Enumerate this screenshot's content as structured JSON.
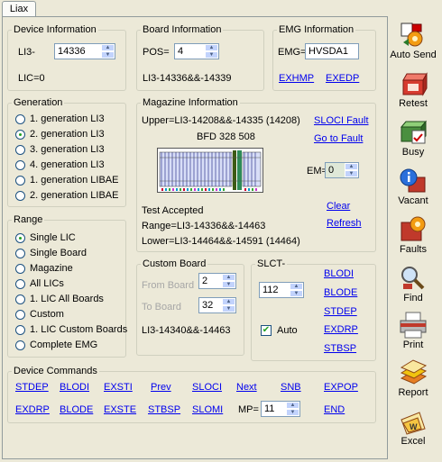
{
  "tab": {
    "label": "Liax"
  },
  "device_info": {
    "legend": "Device Information",
    "li_prefix": "LI3-",
    "li_value": "14336",
    "lic_text": "LIC=0"
  },
  "board_info": {
    "legend": "Board Information",
    "pos_label": "POS=",
    "pos_value": "4",
    "range_text": "LI3-14336&&-14339"
  },
  "emg_info": {
    "legend": "EMG Information",
    "emg_label": "EMG=",
    "emg_value": "HVSDA1",
    "links": [
      "EXHMP",
      "EXEDP"
    ]
  },
  "generation": {
    "legend": "Generation",
    "options": [
      "1. generation LI3",
      "2. generation LI3",
      "3. generation LI3",
      "4. generation LI3",
      "1. generation LIBAE",
      "2. generation LIBAE"
    ],
    "selected_index": 1
  },
  "magazine_info": {
    "legend": "Magazine Information",
    "upper_text": "Upper=LI3-14208&&-14335 (14208)",
    "sloci_fault": "SLOCI Fault",
    "go_to_fault": "Go to Fault",
    "bfd_text": "BFD 328 508",
    "em_label": "EM=",
    "em_value": "0",
    "test_status": "Test Accepted",
    "clear_link": "Clear",
    "refresh_link": "Refresh",
    "range_text": "Range=LI3-14336&&-14463",
    "lower_text": "Lower=LI3-14464&&-14591 (14464)"
  },
  "range": {
    "legend": "Range",
    "options": [
      "Single LIC",
      "Single Board",
      "Magazine",
      "All LICs",
      "1. LIC All Boards",
      "Custom",
      "1. LIC Custom Boards",
      "Complete EMG"
    ],
    "selected_index": 0
  },
  "custom_board": {
    "legend": "Custom Board",
    "from_label": "From Board",
    "from_value": "2",
    "to_label": "To Board",
    "to_value": "32",
    "range_text": "LI3-14340&&-14463"
  },
  "slct": {
    "legend": "SLCT-",
    "value": "112",
    "auto_label": "Auto",
    "auto_checked": true,
    "links": [
      "BLODI",
      "BLODE",
      "STDEP",
      "EXDRP",
      "STBSP"
    ]
  },
  "device_commands": {
    "legend": "Device Commands",
    "row1": [
      "STDEP",
      "BLODI",
      "EXSTI",
      "Prev",
      "SLOCI",
      "Next",
      "SNB",
      "EXPOP"
    ],
    "row2": [
      "EXDRP",
      "BLODE",
      "EXSTE",
      "STBSP",
      "SLOMI"
    ],
    "mp_label": "MP=",
    "mp_value": "11",
    "end_label": "END"
  },
  "toolbar": [
    {
      "label": "Auto Send",
      "icon": "auto-send-icon"
    },
    {
      "label": "Retest",
      "icon": "retest-icon"
    },
    {
      "label": "Busy",
      "icon": "busy-icon"
    },
    {
      "label": "Vacant",
      "icon": "vacant-icon"
    },
    {
      "label": "Faults",
      "icon": "faults-icon"
    },
    {
      "label": "Find",
      "icon": "find-icon"
    },
    {
      "label": "Print",
      "icon": "print-icon"
    },
    {
      "label": "Report",
      "icon": "report-icon"
    },
    {
      "label": "Excel",
      "icon": "excel-icon"
    }
  ],
  "colors": {
    "link": "#0000ee",
    "background": "#ece9d8",
    "spin_button": "#c2d3fc"
  }
}
